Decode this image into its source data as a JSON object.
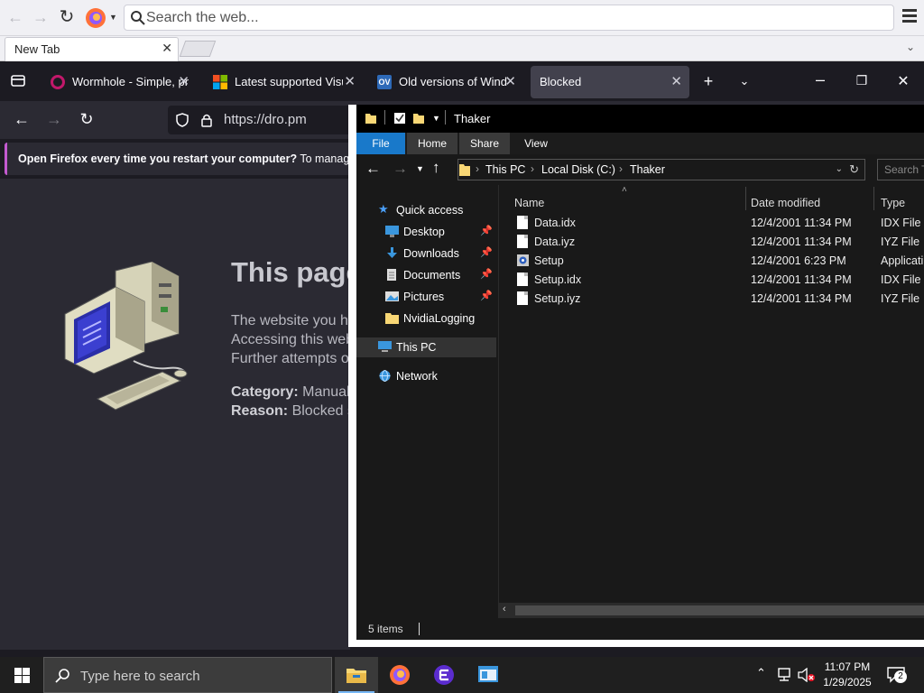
{
  "outer_browser": {
    "search_placeholder": "Search the web...",
    "tab_title": "New Tab",
    "close_glyph": "✕"
  },
  "inner_browser": {
    "tabs": [
      {
        "label": "Wormhole - Simple, pr",
        "favicon": "wormhole-icon"
      },
      {
        "label": "Latest supported Visual",
        "favicon": "microsoft-icon"
      },
      {
        "label": "Old versions of Windo",
        "favicon": "ov-icon",
        "favicon_text": "OV"
      },
      {
        "label": "Blocked",
        "favicon": "none"
      }
    ],
    "url": "https://dro.pm",
    "notification": {
      "bold": "Open Firefox every time you restart your computer?",
      "text": " To manage yo"
    }
  },
  "blocked_page": {
    "title": "This page",
    "lines": [
      "The website you ha",
      "Accessing this web",
      "Further attempts o"
    ],
    "category_label": "Category:",
    "category_value": " Manual",
    "reason_label": "Reason:",
    "reason_value": " Blocked s"
  },
  "explorer": {
    "title": "Thaker",
    "ribbon_tabs": [
      "File",
      "Home",
      "Share",
      "View"
    ],
    "breadcrumb": [
      "This PC",
      "Local Disk (C:)",
      "Thaker"
    ],
    "search_placeholder": "Search Th",
    "nav": [
      {
        "label": "Quick access",
        "icon": "star-icon"
      },
      {
        "label": "Desktop",
        "icon": "desktop-icon",
        "pinned": true
      },
      {
        "label": "Downloads",
        "icon": "download-icon",
        "pinned": true
      },
      {
        "label": "Documents",
        "icon": "documents-icon",
        "pinned": true
      },
      {
        "label": "Pictures",
        "icon": "pictures-icon",
        "pinned": true
      },
      {
        "label": "NvidiaLogging",
        "icon": "folder-icon"
      },
      {
        "label": "This PC",
        "icon": "computer-icon",
        "selected": true
      },
      {
        "label": "Network",
        "icon": "network-icon"
      }
    ],
    "columns": [
      "Name",
      "Date modified",
      "Type"
    ],
    "files": [
      {
        "name": "Data.idx",
        "date": "12/4/2001 11:34 PM",
        "type": "IDX File",
        "icon": "file-icon"
      },
      {
        "name": "Data.iyz",
        "date": "12/4/2001 11:34 PM",
        "type": "IYZ File",
        "icon": "file-icon"
      },
      {
        "name": "Setup",
        "date": "12/4/2001 6:23 PM",
        "type": "Applicati",
        "icon": "setup-icon"
      },
      {
        "name": "Setup.idx",
        "date": "12/4/2001 11:34 PM",
        "type": "IDX File",
        "icon": "file-icon"
      },
      {
        "name": "Setup.iyz",
        "date": "12/4/2001 11:34 PM",
        "type": "IYZ File",
        "icon": "file-icon"
      }
    ],
    "status": "5 items"
  },
  "taskbar": {
    "search_placeholder": "Type here to search",
    "time": "11:07 PM",
    "date": "1/29/2025",
    "notification_count": "2"
  },
  "colors": {
    "firefox_dark": "#1c1b22",
    "explorer_dark": "#191919",
    "file_tab_blue": "#1979ca",
    "taskbar": "#1f1f1f"
  }
}
